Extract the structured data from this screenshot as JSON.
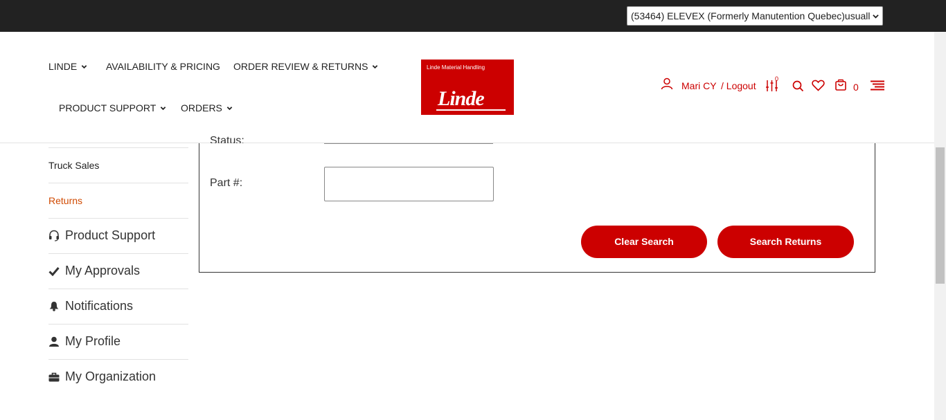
{
  "topbar": {
    "account_select": {
      "value": "(53464) ELEVEX (Formerly Manutention Quebec)usuall"
    }
  },
  "nav": {
    "items": [
      {
        "label": "LINDE",
        "has_dropdown": true
      },
      {
        "label": "AVAILABILITY & PRICING",
        "has_dropdown": false
      },
      {
        "label": "ORDER REVIEW & RETURNS",
        "has_dropdown": true
      },
      {
        "label": "PRODUCT SUPPORT",
        "has_dropdown": true
      },
      {
        "label": "ORDERS",
        "has_dropdown": true
      }
    ]
  },
  "logo": {
    "tagline": "Linde Material Handling",
    "wordmark": "Linde"
  },
  "utility": {
    "user_name": "Mari CY",
    "logout_label": "/ Logout",
    "compare_count": "0",
    "cart_count": "0",
    "icons": [
      "user-icon",
      "compare-icon",
      "search-icon",
      "heart-icon",
      "cart-icon",
      "menu-icon"
    ]
  },
  "sidebar": {
    "links": [
      {
        "label": "Truck Sales",
        "active": false
      },
      {
        "label": "Returns",
        "active": true
      }
    ],
    "sections": [
      {
        "label": "Product Support",
        "icon": "headset-icon"
      },
      {
        "label": "My Approvals",
        "icon": "checkmark-icon"
      },
      {
        "label": "Notifications",
        "icon": "bell-icon"
      },
      {
        "label": "My Profile",
        "icon": "person-icon"
      },
      {
        "label": "My Organization",
        "icon": "briefcase-icon"
      }
    ]
  },
  "form": {
    "status_label": "Status:",
    "part_label": "Part #:",
    "part_value": "",
    "clear_button": "Clear Search",
    "search_button": "Search Returns"
  },
  "colors": {
    "brand_red": "#cc0000",
    "topbar": "#222222",
    "active_link": "#d04a02"
  }
}
